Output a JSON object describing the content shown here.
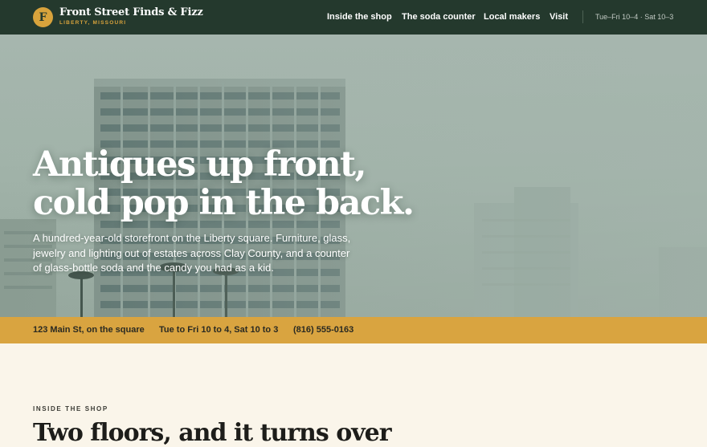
{
  "header": {
    "logo_letter": "F",
    "brand_name": "Front Street Finds & Fizz",
    "brand_location": "LIBERTY, MISSOURI",
    "nav": [
      {
        "label": "Inside the shop"
      },
      {
        "label": "The soda counter"
      },
      {
        "label": "Local makers"
      },
      {
        "label": "Visit"
      }
    ],
    "hours_short": "Tue–Fri 10–4 · Sat 10–3"
  },
  "hero": {
    "title_line1": "Antiques up front,",
    "title_line2": "cold pop in the back.",
    "body": "A hundred-year-old storefront on the Liberty square. Furniture, glass, jewelry and lighting out of estates across Clay County, and a counter of glass-bottle soda and the candy you had as a kid."
  },
  "infobar": {
    "address": "123 Main St, on the square",
    "hours": "Tue to Fri 10 to 4, Sat 10 to 3",
    "phone": "(816) 555-0163"
  },
  "section": {
    "eyebrow": "INSIDE THE SHOP",
    "title": "Two floors, and it turns over"
  },
  "colors": {
    "header_bg": "#24392d",
    "accent_gold": "#d9a440",
    "page_bg": "#faf5ea"
  }
}
